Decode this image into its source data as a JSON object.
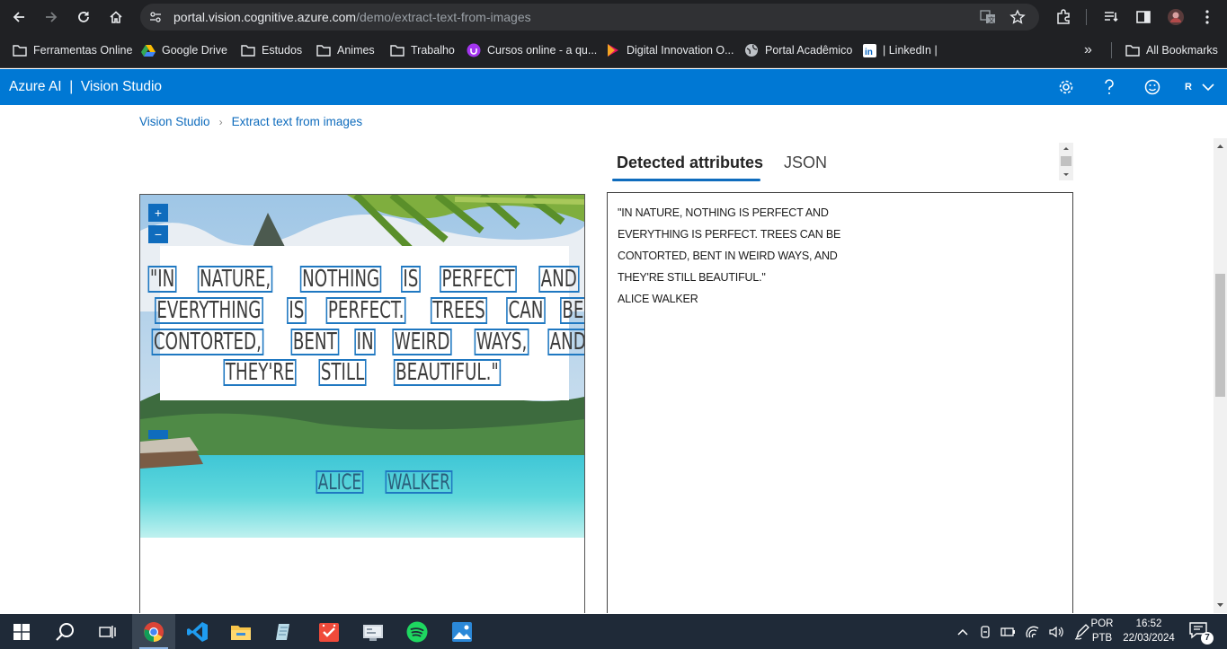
{
  "browser": {
    "url_host": "portal.vision.cognitive.azure.com",
    "url_path": "/demo/extract-text-from-images",
    "nav_icons": [
      "back-icon",
      "forward-icon",
      "reload-icon",
      "home-icon"
    ],
    "bookmarks": [
      {
        "label": "Ferramentas Online",
        "icon": "folder-icon"
      },
      {
        "label": "Google Drive",
        "icon": "google-drive-icon"
      },
      {
        "label": "Estudos",
        "icon": "folder-icon"
      },
      {
        "label": "Animes",
        "icon": "folder-icon"
      },
      {
        "label": "Trabalho",
        "icon": "folder-icon"
      },
      {
        "label": "Cursos online - a qu...",
        "icon": "udemy-icon"
      },
      {
        "label": "Digital Innovation O...",
        "icon": "dio-icon"
      },
      {
        "label": "Portal Acadêmico",
        "icon": "globe-icon"
      },
      {
        "label": "| LinkedIn |",
        "icon": "linkedin-icon"
      }
    ],
    "overflow_label": "»",
    "all_bookmarks_label": "All Bookmarks"
  },
  "app": {
    "brand": "Azure AI  |  Vision Studio",
    "user_initial": "R",
    "accent": "#0078d4"
  },
  "breadcrumb": {
    "root": "Vision Studio",
    "separator": "›",
    "current": "Extract text from images"
  },
  "tabs": {
    "detected": "Detected attributes",
    "json": "JSON"
  },
  "image": {
    "zoom_in": "+",
    "zoom_out": "−",
    "quote_lines": [
      [
        "\"IN",
        "NATURE,",
        "NOTHING",
        "IS",
        "PERFECT",
        "AND"
      ],
      [
        "EVERYTHING",
        "IS",
        "PERFECT.",
        "TREES",
        "CAN",
        "BE"
      ],
      [
        "CONTORTED,",
        "BENT",
        "IN",
        "WEIRD",
        "WAYS,",
        "AND"
      ],
      [
        "THEY'RE",
        "STILL",
        "BEAUTIFUL.\""
      ]
    ],
    "author_words": [
      "ALICE",
      "WALKER"
    ]
  },
  "result": {
    "lines": [
      "\"IN NATURE, NOTHING IS PERFECT AND",
      "EVERYTHING IS PERFECT. TREES CAN BE",
      "CONTORTED, BENT IN WEIRD WAYS, AND",
      "THEY'RE STILL BEAUTIFUL.\"",
      "ALICE WALKER"
    ]
  },
  "taskbar": {
    "apps": [
      "windows-start-icon",
      "search-icon",
      "task-view-icon",
      "chrome-icon",
      "vscode-icon",
      "file-explorer-icon",
      "notepad-icon",
      "todo-icon",
      "control-panel-icon",
      "spotify-icon",
      "photos-icon"
    ],
    "lang_top": "POR",
    "lang_bottom": "PTB",
    "time": "16:52",
    "date": "22/03/2024",
    "notifications": "7"
  }
}
